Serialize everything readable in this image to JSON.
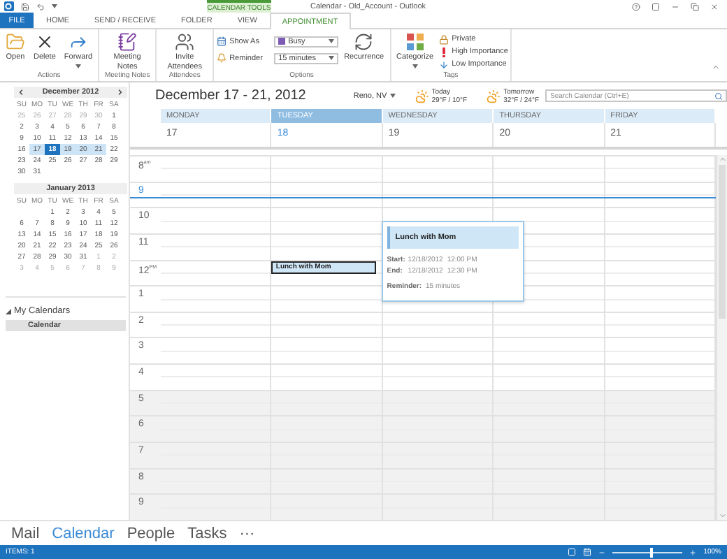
{
  "window": {
    "title": "Calendar - Old_Account - Outlook",
    "context_label": "CALENDAR TOOLS"
  },
  "tabs": [
    {
      "label": "FILE",
      "kind": "file",
      "selected": false
    },
    {
      "label": "HOME",
      "kind": "tab",
      "selected": false
    },
    {
      "label": "SEND / RECEIVE",
      "kind": "tab",
      "selected": false
    },
    {
      "label": "FOLDER",
      "kind": "tab",
      "selected": false
    },
    {
      "label": "VIEW",
      "kind": "tab",
      "selected": false
    },
    {
      "label": "APPOINTMENT",
      "kind": "tab",
      "selected": true
    }
  ],
  "ribbon": {
    "groups": [
      {
        "label": "Actions",
        "items": [
          {
            "kind": "large",
            "label": "Open",
            "dropdown": false
          },
          {
            "kind": "large",
            "label": "Delete",
            "dropdown": false
          },
          {
            "kind": "large",
            "label": "Forward",
            "dropdown": true
          }
        ]
      },
      {
        "label": "Meeting Notes",
        "items": [
          {
            "kind": "large",
            "label": "Meeting Notes",
            "dropdown": false
          }
        ]
      },
      {
        "label": "Attendees",
        "items": [
          {
            "kind": "large",
            "label": "Invite Attendees",
            "dropdown": false
          }
        ]
      },
      {
        "label": "Options",
        "items": [
          {
            "kind": "combo",
            "label": "Show As",
            "value": "Busy"
          },
          {
            "kind": "combo",
            "label": "Reminder",
            "value": "15 minutes"
          },
          {
            "kind": "large",
            "label": "Recurrence",
            "dropdown": false
          }
        ]
      },
      {
        "label": "Tags",
        "items": [
          {
            "kind": "large",
            "label": "Categorize",
            "dropdown": true
          },
          {
            "kind": "small",
            "label": "Private"
          },
          {
            "kind": "small",
            "label": "High Importance"
          },
          {
            "kind": "small",
            "label": "Low Importance"
          }
        ]
      }
    ]
  },
  "mini_calendars": [
    {
      "title": "December 2012",
      "nav": true,
      "weekdays": [
        "SU",
        "MO",
        "TU",
        "WE",
        "TH",
        "FR",
        "SA"
      ],
      "weeks": [
        [
          {
            "d": "25",
            "other": true,
            "range": false,
            "selected": false
          },
          {
            "d": "26",
            "other": true,
            "range": false,
            "selected": false
          },
          {
            "d": "27",
            "other": true,
            "range": false,
            "selected": false
          },
          {
            "d": "28",
            "other": true,
            "range": false,
            "selected": false
          },
          {
            "d": "29",
            "other": true,
            "range": false,
            "selected": false
          },
          {
            "d": "30",
            "other": true,
            "range": false,
            "selected": false
          },
          {
            "d": "1",
            "other": false,
            "range": false,
            "selected": false
          }
        ],
        [
          {
            "d": "2",
            "other": false,
            "range": false,
            "selected": false
          },
          {
            "d": "3",
            "other": false,
            "range": false,
            "selected": false
          },
          {
            "d": "4",
            "other": false,
            "range": false,
            "selected": false
          },
          {
            "d": "5",
            "other": false,
            "range": false,
            "selected": false
          },
          {
            "d": "6",
            "other": false,
            "range": false,
            "selected": false
          },
          {
            "d": "7",
            "other": false,
            "range": false,
            "selected": false
          },
          {
            "d": "8",
            "other": false,
            "range": false,
            "selected": false
          }
        ],
        [
          {
            "d": "9",
            "other": false,
            "range": false,
            "selected": false
          },
          {
            "d": "10",
            "other": false,
            "range": false,
            "selected": false
          },
          {
            "d": "11",
            "other": false,
            "range": false,
            "selected": false
          },
          {
            "d": "12",
            "other": false,
            "range": false,
            "selected": false
          },
          {
            "d": "13",
            "other": false,
            "range": false,
            "selected": false
          },
          {
            "d": "14",
            "other": false,
            "range": false,
            "selected": false
          },
          {
            "d": "15",
            "other": false,
            "range": false,
            "selected": false
          }
        ],
        [
          {
            "d": "16",
            "other": false,
            "range": false,
            "selected": false
          },
          {
            "d": "17",
            "other": false,
            "range": true,
            "selected": false
          },
          {
            "d": "18",
            "other": false,
            "range": true,
            "selected": true
          },
          {
            "d": "19",
            "other": false,
            "range": true,
            "selected": false
          },
          {
            "d": "20",
            "other": false,
            "range": true,
            "selected": false
          },
          {
            "d": "21",
            "other": false,
            "range": true,
            "selected": false
          },
          {
            "d": "22",
            "other": false,
            "range": false,
            "selected": false
          }
        ],
        [
          {
            "d": "23",
            "other": false,
            "range": false,
            "selected": false
          },
          {
            "d": "24",
            "other": false,
            "range": false,
            "selected": false
          },
          {
            "d": "25",
            "other": false,
            "range": false,
            "selected": false
          },
          {
            "d": "26",
            "other": false,
            "range": false,
            "selected": false
          },
          {
            "d": "27",
            "other": false,
            "range": false,
            "selected": false
          },
          {
            "d": "28",
            "other": false,
            "range": false,
            "selected": false
          },
          {
            "d": "29",
            "other": false,
            "range": false,
            "selected": false
          }
        ],
        [
          {
            "d": "30",
            "other": false,
            "range": false,
            "selected": false
          },
          {
            "d": "31",
            "other": false,
            "range": false,
            "selected": false
          }
        ]
      ]
    },
    {
      "title": "January 2013",
      "nav": false,
      "weekdays": [
        "SU",
        "MO",
        "TU",
        "WE",
        "TH",
        "FR",
        "SA"
      ],
      "weeks": [
        [
          {
            "d": "1",
            "other": false,
            "range": false,
            "selected": false
          },
          {
            "d": "2",
            "other": false,
            "range": false,
            "selected": false
          },
          {
            "d": "3",
            "other": false,
            "range": false,
            "selected": false
          },
          {
            "d": "4",
            "other": false,
            "range": false,
            "selected": false
          },
          {
            "d": "5",
            "other": false,
            "range": false,
            "selected": false
          }
        ],
        [
          {
            "d": "6",
            "other": false,
            "range": false,
            "selected": false
          },
          {
            "d": "7",
            "other": false,
            "range": false,
            "selected": false
          },
          {
            "d": "8",
            "other": false,
            "range": false,
            "selected": false
          },
          {
            "d": "9",
            "other": false,
            "range": false,
            "selected": false
          },
          {
            "d": "10",
            "other": false,
            "range": false,
            "selected": false
          },
          {
            "d": "11",
            "other": false,
            "range": false,
            "selected": false
          },
          {
            "d": "12",
            "other": false,
            "range": false,
            "selected": false
          }
        ],
        [
          {
            "d": "13",
            "other": false,
            "range": false,
            "selected": false
          },
          {
            "d": "14",
            "other": false,
            "range": false,
            "selected": false
          },
          {
            "d": "15",
            "other": false,
            "range": false,
            "selected": false
          },
          {
            "d": "16",
            "other": false,
            "range": false,
            "selected": false
          },
          {
            "d": "17",
            "other": false,
            "range": false,
            "selected": false
          },
          {
            "d": "18",
            "other": false,
            "range": false,
            "selected": false
          },
          {
            "d": "19",
            "other": false,
            "range": false,
            "selected": false
          }
        ],
        [
          {
            "d": "20",
            "other": false,
            "range": false,
            "selected": false
          },
          {
            "d": "21",
            "other": false,
            "range": false,
            "selected": false
          },
          {
            "d": "22",
            "other": false,
            "range": false,
            "selected": false
          },
          {
            "d": "23",
            "other": false,
            "range": false,
            "selected": false
          },
          {
            "d": "24",
            "other": false,
            "range": false,
            "selected": false
          },
          {
            "d": "25",
            "other": false,
            "range": false,
            "selected": false
          },
          {
            "d": "26",
            "other": false,
            "range": false,
            "selected": false
          }
        ],
        [
          {
            "d": "27",
            "other": false,
            "range": false,
            "selected": false
          },
          {
            "d": "28",
            "other": false,
            "range": false,
            "selected": false
          },
          {
            "d": "29",
            "other": false,
            "range": false,
            "selected": false
          },
          {
            "d": "30",
            "other": false,
            "range": false,
            "selected": false
          },
          {
            "d": "31",
            "other": false,
            "range": false,
            "selected": false
          },
          {
            "d": "1",
            "other": true,
            "range": false,
            "selected": false
          },
          {
            "d": "2",
            "other": true,
            "range": false,
            "selected": false
          }
        ],
        [
          {
            "d": "3",
            "other": true,
            "range": false,
            "selected": false
          },
          {
            "d": "4",
            "other": true,
            "range": false,
            "selected": false
          },
          {
            "d": "5",
            "other": true,
            "range": false,
            "selected": false
          },
          {
            "d": "6",
            "other": true,
            "range": false,
            "selected": false
          },
          {
            "d": "7",
            "other": true,
            "range": false,
            "selected": false
          },
          {
            "d": "8",
            "other": true,
            "range": false,
            "selected": false
          },
          {
            "d": "9",
            "other": true,
            "range": false,
            "selected": false
          }
        ]
      ]
    }
  ],
  "folders": {
    "heading": "My Calendars",
    "expanded": true,
    "items": [
      {
        "label": "Calendar",
        "selected": true
      }
    ]
  },
  "view": {
    "range": "December 17 - 21, 2012",
    "location": "Reno, NV",
    "weather": [
      {
        "day": "Today",
        "temps": "29°F / 10°F"
      },
      {
        "day": "Tomorrow",
        "temps": "32°F / 24°F"
      }
    ],
    "search": {
      "placeholder": "Search Calendar (Ctrl+E)"
    }
  },
  "days": [
    {
      "name": "MONDAY",
      "date": "17",
      "selected": false
    },
    {
      "name": "TUESDAY",
      "date": "18",
      "selected": true,
      "appointments": [
        {
          "title": "Lunch with Mom",
          "selected": true
        }
      ]
    },
    {
      "name": "WEDNESDAY",
      "date": "19",
      "selected": false
    },
    {
      "name": "THURSDAY",
      "date": "20",
      "selected": false
    },
    {
      "name": "FRIDAY",
      "date": "21",
      "selected": false
    }
  ],
  "hours": [
    {
      "label": "8",
      "suffix": "am",
      "work": true,
      "now": false
    },
    {
      "label": "9",
      "work": true,
      "now": true
    },
    {
      "label": "10",
      "work": true,
      "now": false
    },
    {
      "label": "11",
      "work": true,
      "now": false
    },
    {
      "label": "12",
      "suffix": "PM",
      "work": true,
      "now": false
    },
    {
      "label": "1",
      "work": true,
      "now": false
    },
    {
      "label": "2",
      "work": true,
      "now": false
    },
    {
      "label": "3",
      "work": true,
      "now": false
    },
    {
      "label": "4",
      "work": true,
      "now": false
    },
    {
      "label": "5",
      "work": false,
      "now": false
    },
    {
      "label": "6",
      "work": false,
      "now": false
    },
    {
      "label": "7",
      "work": false,
      "now": false
    },
    {
      "label": "8",
      "work": false,
      "now": false
    },
    {
      "label": "9",
      "work": false,
      "now": false
    }
  ],
  "peek": {
    "title": "Lunch with Mom",
    "fields": [
      {
        "label": "Start:",
        "date": "12/18/2012",
        "time": "12:00 PM"
      },
      {
        "label": "End:",
        "date": "12/18/2012",
        "time": "12:30 PM"
      }
    ],
    "reminder": {
      "label": "Reminder:",
      "value": "15 minutes"
    }
  },
  "nav": [
    {
      "label": "Mail",
      "selected": false
    },
    {
      "label": "Calendar",
      "selected": true
    },
    {
      "label": "People",
      "selected": false
    },
    {
      "label": "Tasks",
      "selected": false
    },
    {
      "label": "···",
      "selected": false
    }
  ],
  "status_bar": {
    "items": "ITEMS: 1",
    "zoom": {
      "level": 0.55,
      "reading": "100%"
    }
  }
}
